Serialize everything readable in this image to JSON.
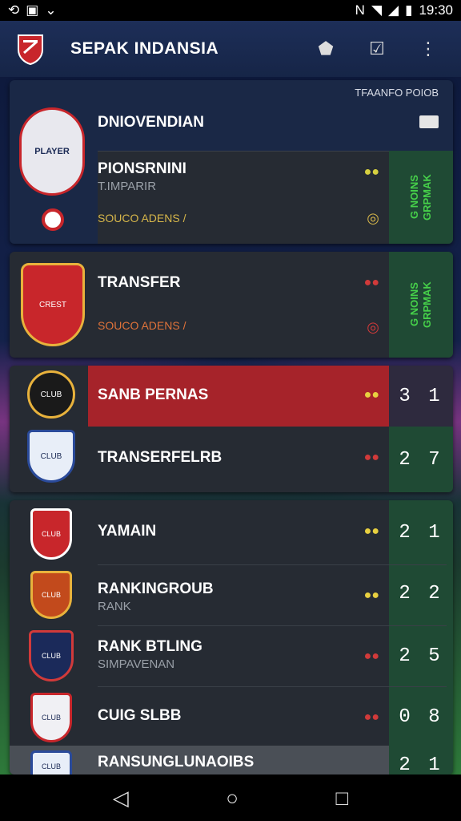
{
  "status_bar": {
    "left_icons": [
      "sync-icon",
      "gallery-icon",
      "chevron-icon"
    ],
    "time": "19:30"
  },
  "app_bar": {
    "title": "SEPAK INDANSIA",
    "actions": [
      "shield-icon",
      "check-icon",
      "more-icon"
    ]
  },
  "header_label": "TFAANFO POIOB",
  "cards": {
    "c1": {
      "title": "DNIOVENDIAN",
      "player": "PIONSRNINI",
      "player_sub": "T.IMPARIR",
      "stat_text": "SOUCO ADENS /",
      "green_text": [
        "G NOINS",
        "GRPMAK"
      ]
    },
    "c2": {
      "player": "TRANSFER",
      "stat_text": "SOUCO ADENS /",
      "green_text": [
        "G NOINS",
        "GRPMAK"
      ]
    },
    "c3": {
      "rows": [
        {
          "name": "SANB PERNAS",
          "score": "3 1"
        },
        {
          "name": "TRANSERFELRB",
          "score": "2 7"
        }
      ]
    },
    "c4": {
      "rows": [
        {
          "name": "YAMAIN",
          "sub": "",
          "score": "2 1"
        },
        {
          "name": "RANKINGROUB",
          "sub": "RANK",
          "score": "2 2"
        },
        {
          "name": "RANK BTLING",
          "sub": "SIMPAVENAN",
          "score": "2 5"
        },
        {
          "name": "CUIG SLBB",
          "sub": "",
          "score": "0 8"
        },
        {
          "name": "RANSUNGLUNAOIBS",
          "sub": "",
          "score": "2 1"
        }
      ]
    }
  },
  "nav": {
    "buttons": [
      "back-icon",
      "home-icon",
      "recents-icon"
    ]
  }
}
